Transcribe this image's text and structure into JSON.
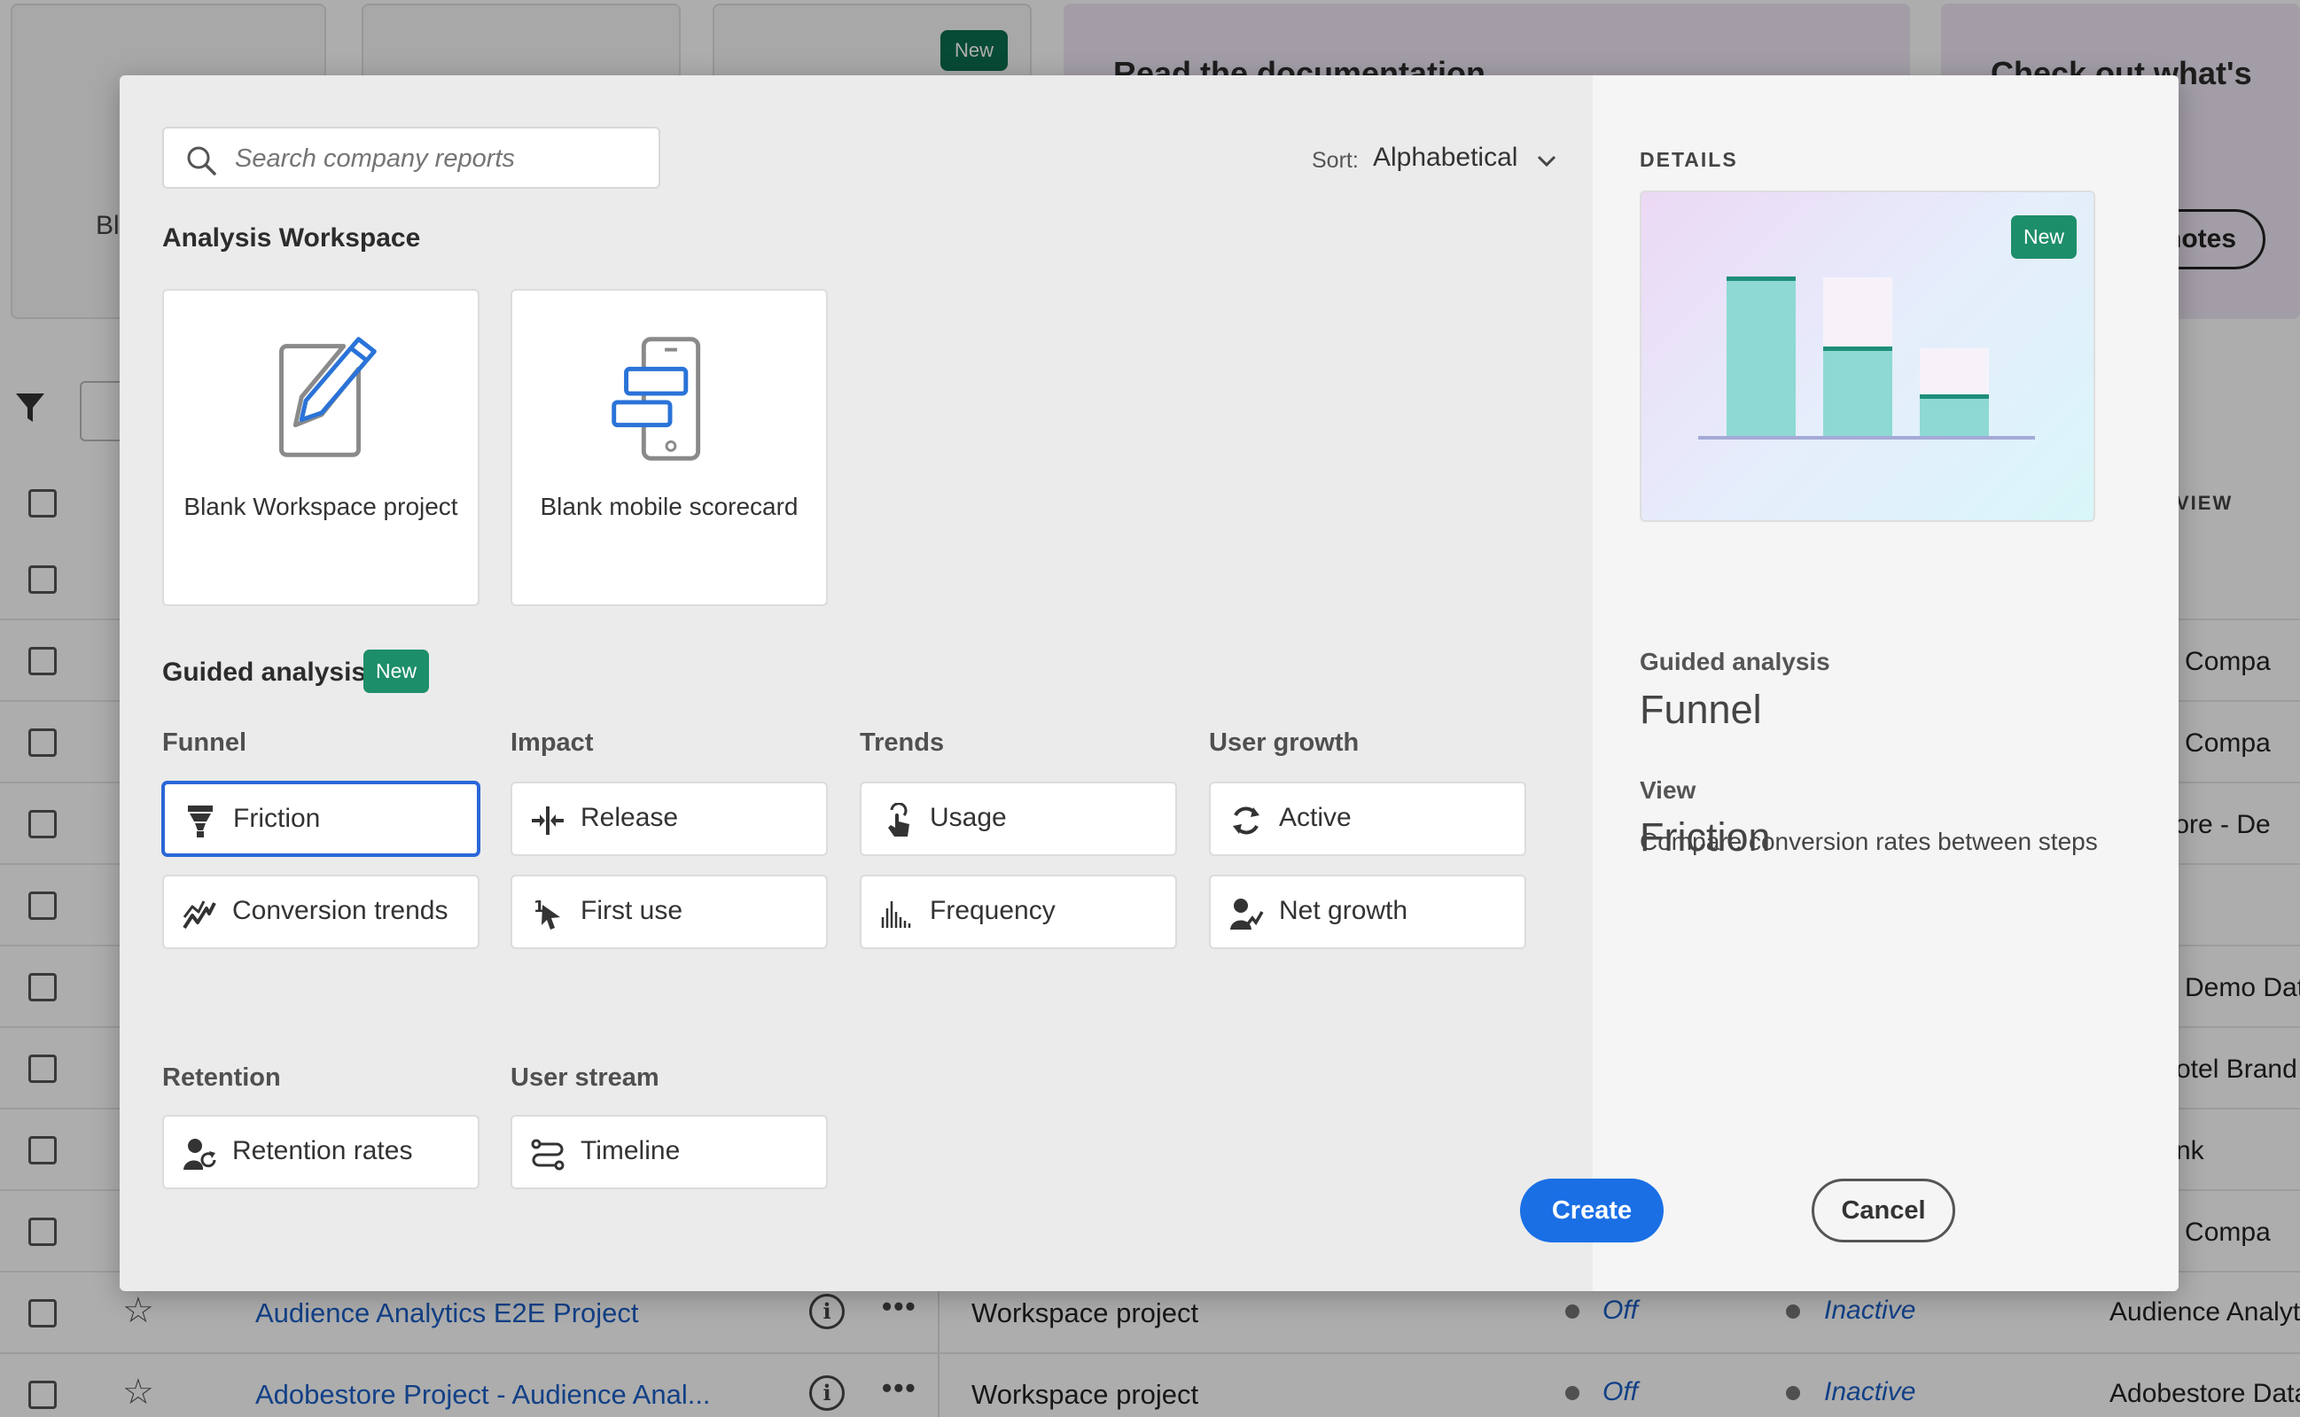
{
  "background": {
    "cards": [
      {
        "visible_label": "Bl"
      },
      {
        "visible_label": ""
      },
      {
        "badge": "New"
      }
    ],
    "promo_docs_title": "Read the documentation",
    "promo_whats_new_title": "Check out what's new",
    "promo_notes_button": "notes",
    "column_header_fragment": "VIEW",
    "rows_tail_text": [
      "edia Compa",
      "edia Compa",
      "e Store - De",
      "",
      "Demo Dat",
      "otel Brand",
      "nk",
      "edia Compa"
    ],
    "table_rows": [
      {
        "name": "Audience Analytics E2E Project",
        "type": "Workspace project",
        "status1": "Off",
        "status2": "Inactive",
        "tail": "Audience Analyti"
      },
      {
        "name": "Adobestore Project - Audience Anal...",
        "type": "Workspace project",
        "status1": "Off",
        "status2": "Inactive",
        "tail": "Adobestore Data"
      }
    ]
  },
  "modal": {
    "search": {
      "placeholder": "Search company reports",
      "value": ""
    },
    "sort": {
      "label": "Sort:",
      "value": "Alphabetical"
    },
    "analysis_workspace": {
      "title": "Analysis Workspace",
      "tiles": [
        {
          "label": "Blank Workspace project",
          "icon": "pencil-document-icon"
        },
        {
          "label": "Blank mobile scorecard",
          "icon": "mobile-scorecard-icon"
        }
      ]
    },
    "guided_analysis": {
      "title": "Guided analysis",
      "badge": "New",
      "categories": {
        "funnel": {
          "header": "Funnel",
          "options": [
            {
              "label": "Friction",
              "icon": "funnel-icon",
              "selected": true
            },
            {
              "label": "Conversion trends",
              "icon": "trend-line-icon"
            }
          ]
        },
        "impact": {
          "header": "Impact",
          "options": [
            {
              "label": "Release",
              "icon": "release-icon"
            },
            {
              "label": "First use",
              "icon": "first-use-icon"
            }
          ]
        },
        "trends": {
          "header": "Trends",
          "options": [
            {
              "label": "Usage",
              "icon": "touch-icon"
            },
            {
              "label": "Frequency",
              "icon": "histogram-icon"
            }
          ]
        },
        "user_growth": {
          "header": "User growth",
          "options": [
            {
              "label": "Active",
              "icon": "refresh-icon"
            },
            {
              "label": "Net growth",
              "icon": "user-growth-icon"
            }
          ]
        },
        "retention": {
          "header": "Retention",
          "options": [
            {
              "label": "Retention rates",
              "icon": "user-refresh-icon"
            }
          ]
        },
        "user_stream": {
          "header": "User stream",
          "options": [
            {
              "label": "Timeline",
              "icon": "timeline-icon"
            }
          ]
        }
      }
    },
    "details": {
      "title": "DETAILS",
      "preview_badge": "New",
      "category_label": "Guided analysis",
      "category_value": "Funnel",
      "view_label": "View",
      "view_value": "Friction",
      "description": "Compare conversion rates between steps"
    },
    "buttons": {
      "cancel": "Cancel",
      "create": "Create"
    },
    "colors": {
      "accent": "#1a6fe5",
      "badge": "#1d8e6a",
      "chart_bar": "#8ed9d4",
      "chart_line": "#1f8f7a"
    }
  }
}
